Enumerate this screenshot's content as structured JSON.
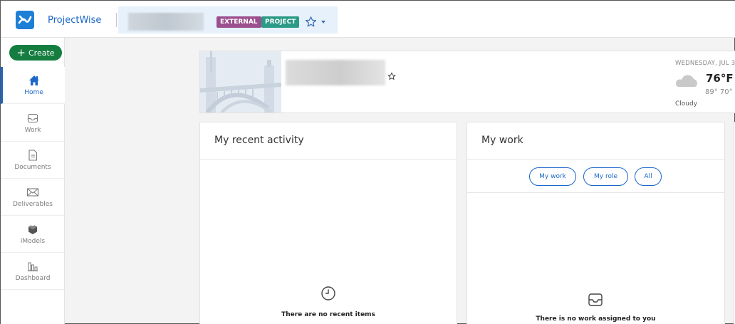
{
  "app": {
    "name": "ProjectWise",
    "badges": [
      "EXTERNAL",
      "PROJECT"
    ]
  },
  "sidebar": {
    "create_label": "Create",
    "items": [
      {
        "label": "Home",
        "icon": "home-icon",
        "active": true
      },
      {
        "label": "Work",
        "icon": "inbox-icon",
        "active": false
      },
      {
        "label": "Documents",
        "icon": "document-icon",
        "active": false
      },
      {
        "label": "Deliverables",
        "icon": "envelope-icon",
        "active": false
      },
      {
        "label": "iModels",
        "icon": "imodel-icon",
        "active": false
      },
      {
        "label": "Dashboard",
        "icon": "bar-chart-icon",
        "active": false
      }
    ]
  },
  "weather": {
    "date": "WEDNESDAY, JUL 3",
    "temperature": "76°F",
    "high_low": "89° 70°",
    "condition": "Cloudy"
  },
  "panels": {
    "recent": {
      "title": "My recent activity",
      "empty_text": "There are no recent items"
    },
    "work": {
      "title": "My work",
      "filters": [
        "My work",
        "My role",
        "All"
      ],
      "empty_text": "There is no work assigned to you"
    }
  },
  "colors": {
    "accent": "#1b66c9",
    "create_button": "#147d3f",
    "badge_external": "#9b4f8f",
    "badge_project": "#2b9a86"
  }
}
